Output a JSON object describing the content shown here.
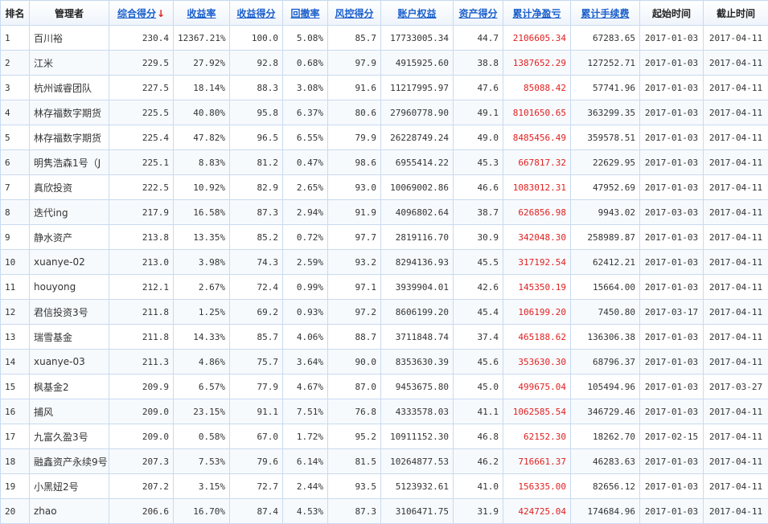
{
  "table": {
    "headers": [
      {
        "label": "排名",
        "sortable": false
      },
      {
        "label": "管理者",
        "sortable": false
      },
      {
        "label": "综合得分",
        "sortable": true,
        "sorted_desc": true
      },
      {
        "label": "收益率",
        "sortable": true
      },
      {
        "label": "收益得分",
        "sortable": true
      },
      {
        "label": "回撤率",
        "sortable": true
      },
      {
        "label": "风控得分",
        "sortable": true
      },
      {
        "label": "账户权益",
        "sortable": true
      },
      {
        "label": "资产得分",
        "sortable": true
      },
      {
        "label": "累计净盈亏",
        "sortable": true
      },
      {
        "label": "累计手续费",
        "sortable": true
      },
      {
        "label": "起始时间",
        "sortable": false
      },
      {
        "label": "截止时间",
        "sortable": false
      }
    ],
    "sort_arrow": "↓",
    "rows": [
      [
        "1",
        "百川裕",
        "230.4",
        "12367.21%",
        "100.0",
        "5.08%",
        "85.7",
        "17733005.34",
        "44.7",
        "2106605.34",
        "67283.65",
        "2017-01-03",
        "2017-04-11"
      ],
      [
        "2",
        "江米",
        "229.5",
        "27.92%",
        "92.8",
        "0.68%",
        "97.9",
        "4915925.60",
        "38.8",
        "1387652.29",
        "127252.71",
        "2017-01-03",
        "2017-04-11"
      ],
      [
        "3",
        "杭州诚睿团队",
        "227.5",
        "18.14%",
        "88.3",
        "3.08%",
        "91.6",
        "11217995.97",
        "47.6",
        "85088.42",
        "57741.96",
        "2017-01-03",
        "2017-04-11"
      ],
      [
        "4",
        "林存福数字期货",
        "225.5",
        "40.80%",
        "95.8",
        "6.37%",
        "80.6",
        "27960778.90",
        "49.1",
        "8101650.65",
        "363299.35",
        "2017-01-03",
        "2017-04-11"
      ],
      [
        "5",
        "林存福数字期货",
        "225.4",
        "47.82%",
        "96.5",
        "6.55%",
        "79.9",
        "26228749.24",
        "49.0",
        "8485456.49",
        "359578.51",
        "2017-01-03",
        "2017-04-11"
      ],
      [
        "6",
        "明隽浩森1号（J",
        "225.1",
        "8.83%",
        "81.2",
        "0.47%",
        "98.6",
        "6955414.22",
        "45.3",
        "667817.32",
        "22629.95",
        "2017-01-03",
        "2017-04-11"
      ],
      [
        "7",
        "真欣投资",
        "222.5",
        "10.92%",
        "82.9",
        "2.65%",
        "93.0",
        "10069002.86",
        "46.6",
        "1083012.31",
        "47952.69",
        "2017-01-03",
        "2017-04-11"
      ],
      [
        "8",
        "迭代ing",
        "217.9",
        "16.58%",
        "87.3",
        "2.94%",
        "91.9",
        "4096802.64",
        "38.7",
        "626856.98",
        "9943.02",
        "2017-03-03",
        "2017-04-11"
      ],
      [
        "9",
        "静水资产",
        "213.8",
        "13.35%",
        "85.2",
        "0.72%",
        "97.7",
        "2819116.70",
        "30.9",
        "342048.30",
        "258989.87",
        "2017-01-03",
        "2017-04-11"
      ],
      [
        "10",
        "xuanye-02",
        "213.0",
        "3.98%",
        "74.3",
        "2.59%",
        "93.2",
        "8294136.93",
        "45.5",
        "317192.54",
        "62412.21",
        "2017-01-03",
        "2017-04-11"
      ],
      [
        "11",
        "houyong",
        "212.1",
        "2.67%",
        "72.4",
        "0.99%",
        "97.1",
        "3939904.01",
        "42.6",
        "145350.19",
        "15664.00",
        "2017-01-03",
        "2017-04-11"
      ],
      [
        "12",
        "君信投资3号",
        "211.8",
        "1.25%",
        "69.2",
        "0.93%",
        "97.2",
        "8606199.20",
        "45.4",
        "106199.20",
        "7450.80",
        "2017-03-17",
        "2017-04-11"
      ],
      [
        "13",
        "瑞雪基金",
        "211.8",
        "14.33%",
        "85.7",
        "4.06%",
        "88.7",
        "3711848.74",
        "37.4",
        "465188.62",
        "136306.38",
        "2017-01-03",
        "2017-04-11"
      ],
      [
        "14",
        "xuanye-03",
        "211.3",
        "4.86%",
        "75.7",
        "3.64%",
        "90.0",
        "8353630.39",
        "45.6",
        "353630.30",
        "68796.37",
        "2017-01-03",
        "2017-04-11"
      ],
      [
        "15",
        "枫基金2",
        "209.9",
        "6.57%",
        "77.9",
        "4.67%",
        "87.0",
        "9453675.80",
        "45.0",
        "499675.04",
        "105494.96",
        "2017-01-03",
        "2017-03-27"
      ],
      [
        "16",
        "捕风",
        "209.0",
        "23.15%",
        "91.1",
        "7.51%",
        "76.8",
        "4333578.03",
        "41.1",
        "1062585.54",
        "346729.46",
        "2017-01-03",
        "2017-04-11"
      ],
      [
        "17",
        "九富久盈3号",
        "209.0",
        "0.58%",
        "67.0",
        "1.72%",
        "95.2",
        "10911152.30",
        "46.8",
        "62152.30",
        "18262.70",
        "2017-02-15",
        "2017-04-11"
      ],
      [
        "18",
        "融鑫资产永续9号",
        "207.3",
        "7.53%",
        "79.6",
        "6.14%",
        "81.5",
        "10264877.53",
        "46.2",
        "716661.37",
        "46283.63",
        "2017-01-03",
        "2017-04-11"
      ],
      [
        "19",
        "小黑妞2号",
        "207.2",
        "3.15%",
        "72.7",
        "2.44%",
        "93.5",
        "5123932.61",
        "41.0",
        "156335.00",
        "82656.12",
        "2017-01-03",
        "2017-04-11"
      ],
      [
        "20",
        "zhao",
        "206.6",
        "16.70%",
        "87.4",
        "4.53%",
        "87.3",
        "3106471.75",
        "31.9",
        "424725.04",
        "174684.96",
        "2017-01-03",
        "2017-04-11"
      ]
    ]
  },
  "colors": {
    "header_link": "#1a5fcc",
    "positive_profit": "#e02020",
    "sort_arrow": "#e02020",
    "grid_border": "#c9daf0"
  }
}
